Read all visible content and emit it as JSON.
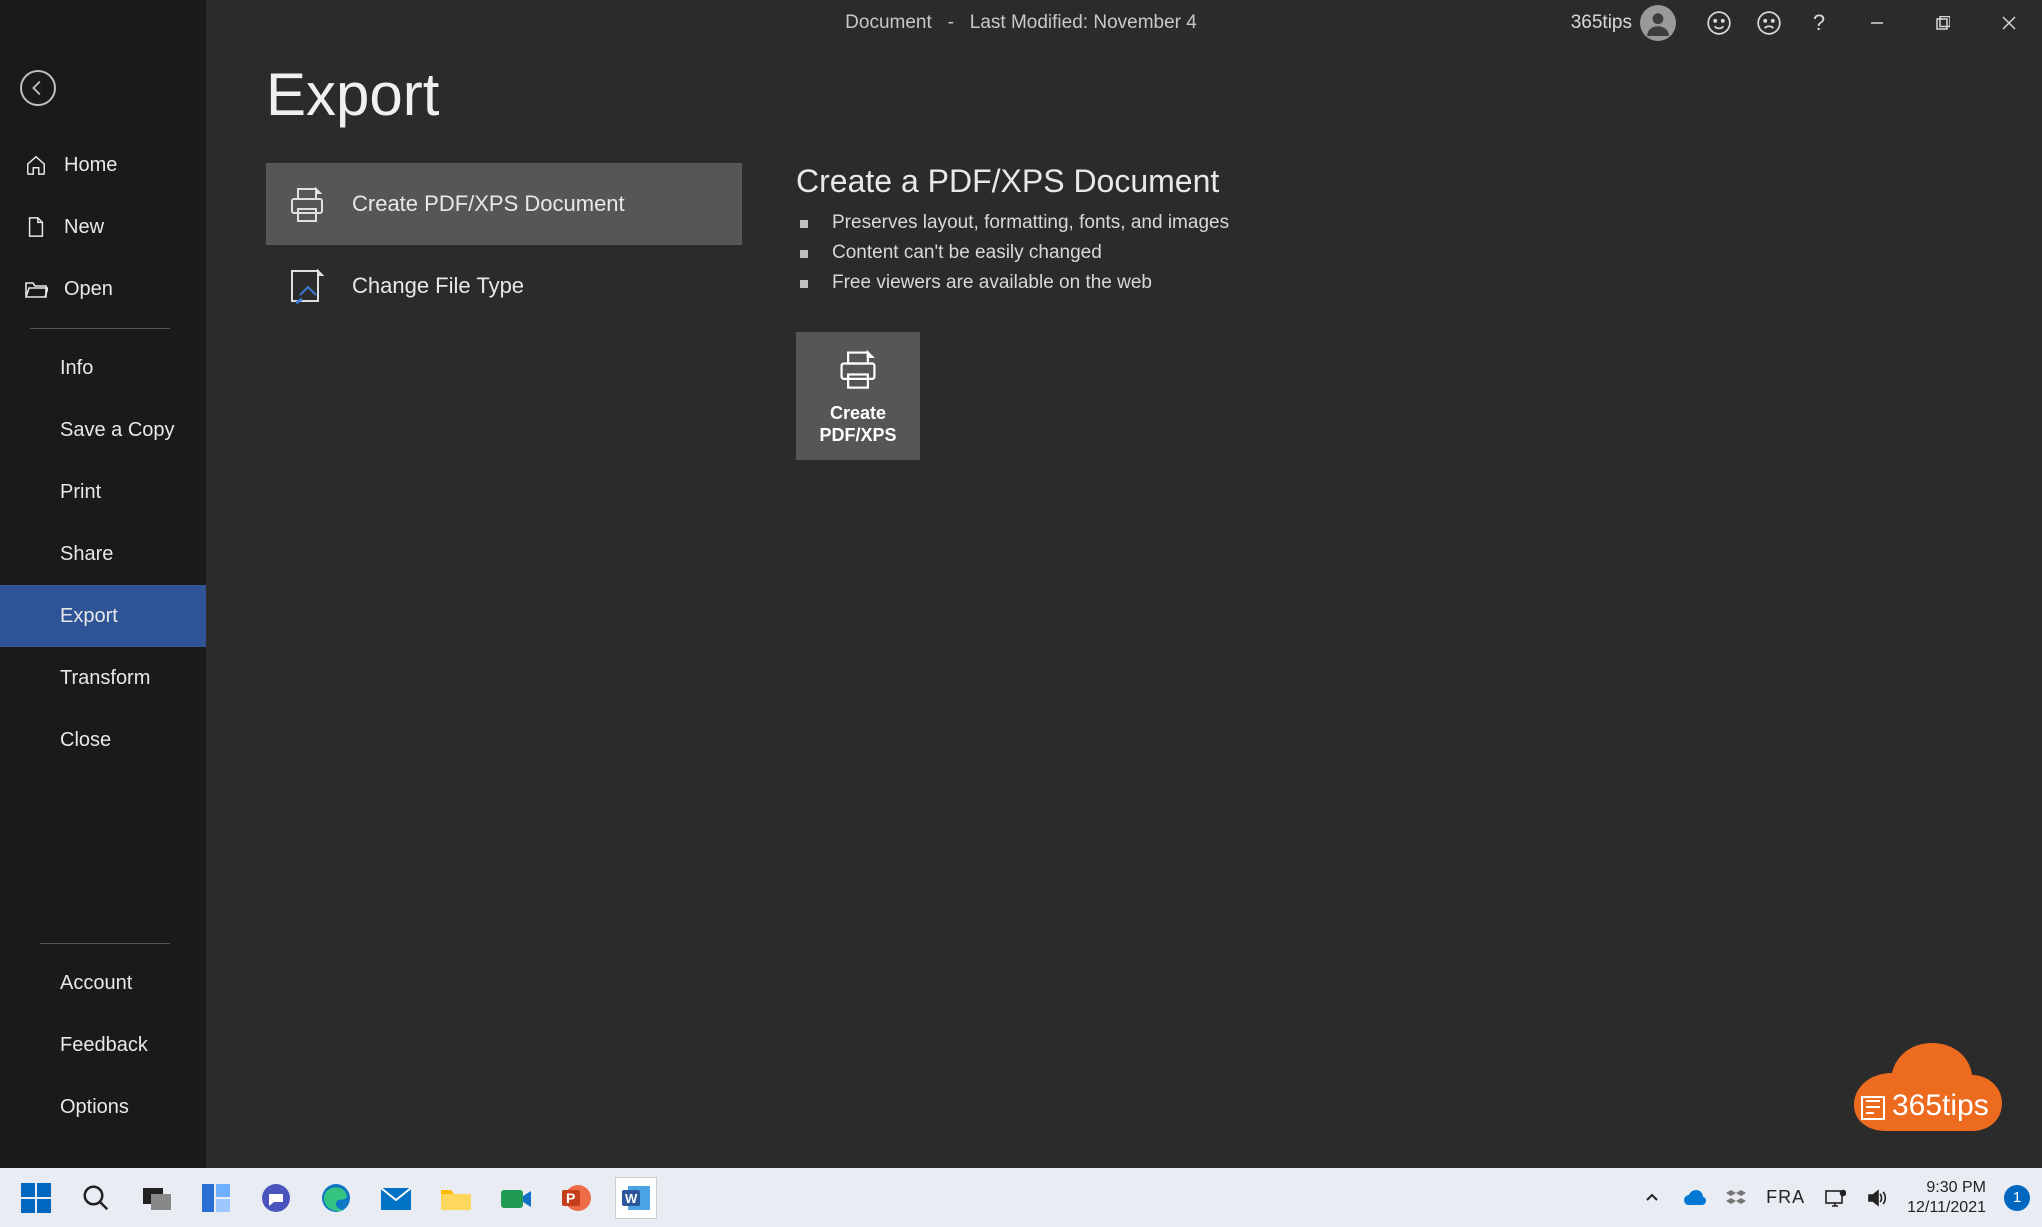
{
  "titlebar": {
    "doc_name": "Document",
    "separator": "-",
    "last_modified": "Last Modified: November 4",
    "username": "365tips"
  },
  "sidebar": {
    "home": "Home",
    "new": "New",
    "open": "Open",
    "info": "Info",
    "save_copy": "Save a Copy",
    "print": "Print",
    "share": "Share",
    "export": "Export",
    "transform": "Transform",
    "close": "Close",
    "account": "Account",
    "feedback": "Feedback",
    "options": "Options"
  },
  "main": {
    "title": "Export",
    "options": {
      "pdfxps": "Create PDF/XPS Document",
      "filetype": "Change File Type"
    },
    "details": {
      "heading": "Create a PDF/XPS Document",
      "bullet1": "Preserves layout, formatting, fonts, and images",
      "bullet2": "Content can't be easily changed",
      "bullet3": "Free viewers are available on the web",
      "button_line1": "Create",
      "button_line2": "PDF/XPS"
    }
  },
  "badge": {
    "text": "365tips"
  },
  "taskbar": {
    "lang": "FRA",
    "time": "9:30 PM",
    "date": "12/11/2021",
    "notif_count": "1"
  }
}
